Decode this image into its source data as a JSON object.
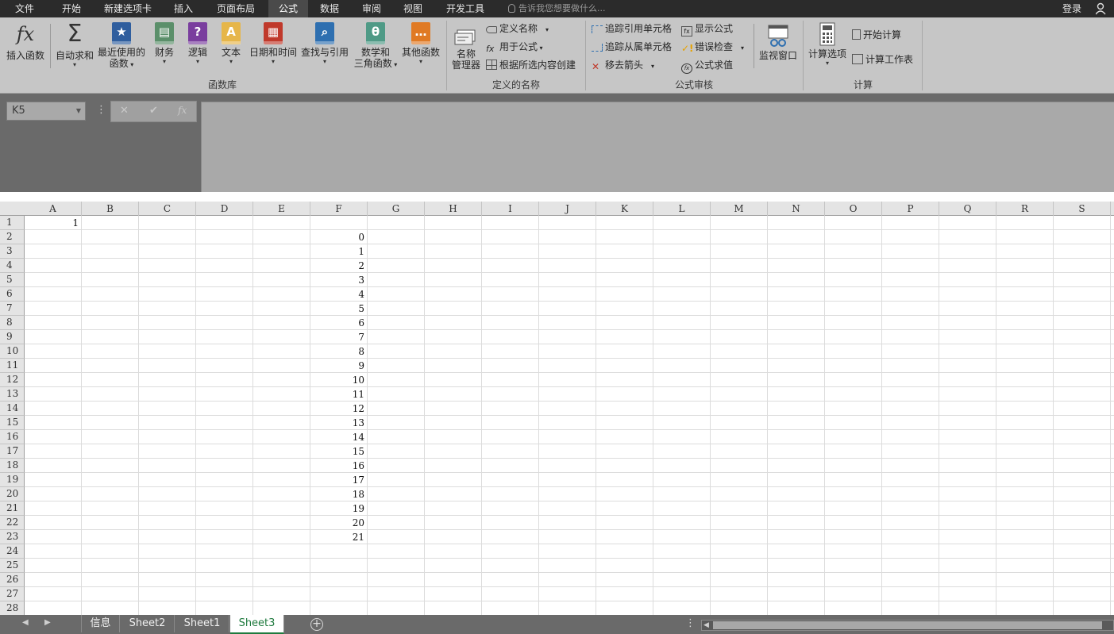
{
  "tabs": [
    "文件",
    "开始",
    "新建选项卡",
    "插入",
    "页面布局",
    "公式",
    "数据",
    "审阅",
    "视图",
    "开发工具"
  ],
  "active_tab": "公式",
  "tell_me": "告诉我您想要做什么...",
  "login": "登录",
  "ribbon": {
    "insert_function": "插入函数",
    "autosum": "自动求和",
    "recent_line1": "最近使用的",
    "recent_line2": "函数",
    "financial": "财务",
    "logical": "逻辑",
    "text": "文本",
    "datetime": "日期和时间",
    "lookup": "查找与引用",
    "math_line1": "数学和",
    "math_line2": "三角函数",
    "more": "其他函数",
    "group_library": "函数库",
    "name_mgr_line1": "名称",
    "name_mgr_line2": "管理器",
    "define_name": "定义名称",
    "use_in_formula": "用于公式",
    "create_from_sel": "根据所选内容创建",
    "group_names": "定义的名称",
    "trace_precedents": "追踪引用单元格",
    "trace_dependents": "追踪从属单元格",
    "remove_arrows": "移去箭头",
    "show_formulas": "显示公式",
    "error_checking": "错误检查",
    "evaluate_formula": "公式求值",
    "watch_window": "监视窗口",
    "group_auditing": "公式审核",
    "calc_options": "计算选项",
    "calc_now": "开始计算",
    "calc_sheet": "计算工作表",
    "group_calc": "计算"
  },
  "name_box": "K5",
  "formula": "",
  "columns": [
    "A",
    "B",
    "C",
    "D",
    "E",
    "F",
    "G",
    "H",
    "I",
    "J",
    "K",
    "L",
    "M",
    "N",
    "O",
    "P",
    "Q",
    "R",
    "S"
  ],
  "rows": [
    "1",
    "2",
    "3",
    "4",
    "5",
    "6",
    "7",
    "8",
    "9",
    "10",
    "11",
    "12",
    "13",
    "14",
    "15",
    "16",
    "17",
    "18",
    "19",
    "20",
    "21",
    "22",
    "23",
    "24",
    "25",
    "26",
    "27",
    "28"
  ],
  "cells": {
    "A1": "1",
    "F": [
      "0",
      "1",
      "2",
      "3",
      "4",
      "5",
      "6",
      "7",
      "8",
      "9",
      "10",
      "11",
      "12",
      "13",
      "14",
      "15",
      "16",
      "17",
      "18",
      "19",
      "20",
      "21"
    ]
  },
  "sheets": [
    "信息",
    "Sheet2",
    "Sheet1",
    "Sheet3"
  ],
  "active_sheet": "Sheet3",
  "colors": {
    "ribbon_bg": "#c6c6c6",
    "tab_bar": "#2b2b2b",
    "active_sheet_text": "#1f7a3e"
  }
}
